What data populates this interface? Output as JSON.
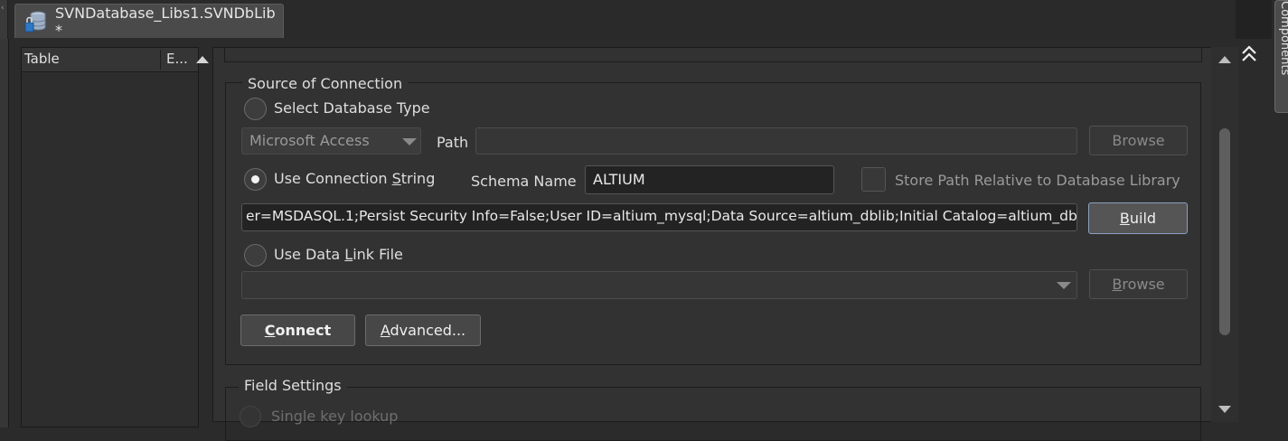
{
  "tab": {
    "title": "SVNDatabase_Libs1.SVNDbLib *",
    "icon": "database-icon"
  },
  "side_panel": {
    "label": "Components"
  },
  "table_panel": {
    "col_table": "Table",
    "col_e": "E..."
  },
  "source": {
    "legend": "Source of Connection",
    "select_db_type": {
      "label": "Select Database Type",
      "selected": false
    },
    "db_type": {
      "value": "Microsoft Access"
    },
    "path": {
      "label": "Path",
      "value": "",
      "browse": "Browse"
    },
    "use_conn_string": {
      "label_pre": "Use Connection ",
      "label_ul": "S",
      "label_post": "tring",
      "selected": true
    },
    "schema": {
      "label": "Schema Name",
      "value": "ALTIUM"
    },
    "store_relative": {
      "label": "Store Path Relative to Database Library",
      "checked": false
    },
    "conn_string": {
      "value": "er=MSDASQL.1;Persist Security Info=False;User ID=altium_mysql;Data Source=altium_dblib;Initial Catalog=altium_dblib"
    },
    "build": {
      "ul": "B",
      "rest": "uild"
    },
    "use_data_link": {
      "label_pre": "Use Data ",
      "label_ul": "L",
      "label_post": "ink File",
      "selected": false
    },
    "link_browse": {
      "ul": "B",
      "rest": "rowse"
    },
    "connect": {
      "ul": "C",
      "rest": "onnect"
    },
    "advanced": {
      "ul": "A",
      "rest": "dvanced..."
    }
  },
  "field_settings": {
    "legend": "Field Settings",
    "single_key": "Single key lookup"
  },
  "colors": {
    "background": "#2b2b2b",
    "panel": "#323232",
    "accent_border": "#8aa0c0"
  }
}
